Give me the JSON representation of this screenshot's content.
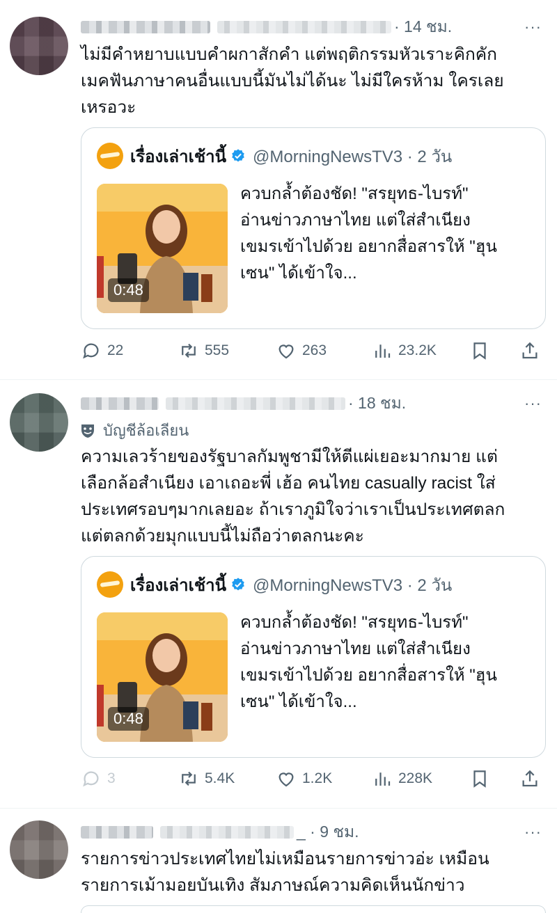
{
  "tweets": [
    {
      "time": "· 14 ชม.",
      "more": "···",
      "lines": [
        "ไม่มีคำหยาบแบบคำผกาสักคำ แต่พฤติกรรมหัวเราะคิกคัก",
        "เมคฟันภาษาคนอื่นแบบนี้มันไม่ได้นะ ไม่มีใครห้าม ใครเลย",
        "เหรอวะ"
      ],
      "quote": {
        "name": "เรื่องเล่าเช้านี้",
        "handle": "@MorningNewsTV3 · 2 วัน",
        "duration": "0:48",
        "lines": [
          "ควบกล้ำต้องชัด! \"สรยุทธ-ไบรท์\"",
          "อ่านข่าวภาษาไทย แต่ใส่สำเนียง",
          "เขมรเข้าไปด้วย อยากสื่อสารให้ \"ฮุน",
          "เซน\" ได้เข้าใจ..."
        ]
      },
      "actions": {
        "replies": "22",
        "reposts": "555",
        "likes": "263",
        "views": "23.2K"
      }
    },
    {
      "time": "· 18 ชม.",
      "more": "···",
      "parody_label": "บัญชีล้อเลียน",
      "lines": [
        "ความเลวร้ายของรัฐบาลกัมพูชามีให้ตีแผ่เยอะมากมาย แต่",
        "เลือกล้อสำเนียง เอาเถอะพี่ เฮ้อ คนไทย casually racist ใส่",
        "ประเทศรอบๆมากเลยอะ ถ้าเราภูมิใจว่าเราเป็นประเทศตลก",
        "แต่ตลกด้วยมุกแบบนี้ไม่ถือว่าตลกนะคะ"
      ],
      "quote": {
        "name": "เรื่องเล่าเช้านี้",
        "handle": "@MorningNewsTV3 · 2 วัน",
        "duration": "0:48",
        "lines": [
          "ควบกล้ำต้องชัด! \"สรยุทธ-ไบรท์\"",
          "อ่านข่าวภาษาไทย แต่ใส่สำเนียง",
          "เขมรเข้าไปด้วย อยากสื่อสารให้ \"ฮุน",
          "เซน\" ได้เข้าใจ..."
        ]
      },
      "actions": {
        "replies": "3",
        "reposts": "5.4K",
        "likes": "1.2K",
        "views": "228K"
      }
    },
    {
      "time": "_ · 9 ชม.",
      "more": "···",
      "lines": [
        "รายการข่าวประเทศไทยไม่เหมือนรายการข่าวอ่ะ เหมือน",
        "รายการเม้ามอยบันเทิง สัมภาษณ์ความคิดเห็นนักข่าว"
      ]
    }
  ],
  "icons": {
    "reply": "reply-icon",
    "repost": "repost-icon",
    "like": "heart-icon",
    "views": "views-icon",
    "bookmark": "bookmark-icon",
    "share": "share-icon",
    "verified": "verified-badge-icon",
    "parody": "parody-mask-icon"
  },
  "colors": {
    "text": "#0f1419",
    "muted": "#536471",
    "border": "#cfd9de",
    "verified": "#1d9bf0",
    "logo": "#f3a10f"
  }
}
